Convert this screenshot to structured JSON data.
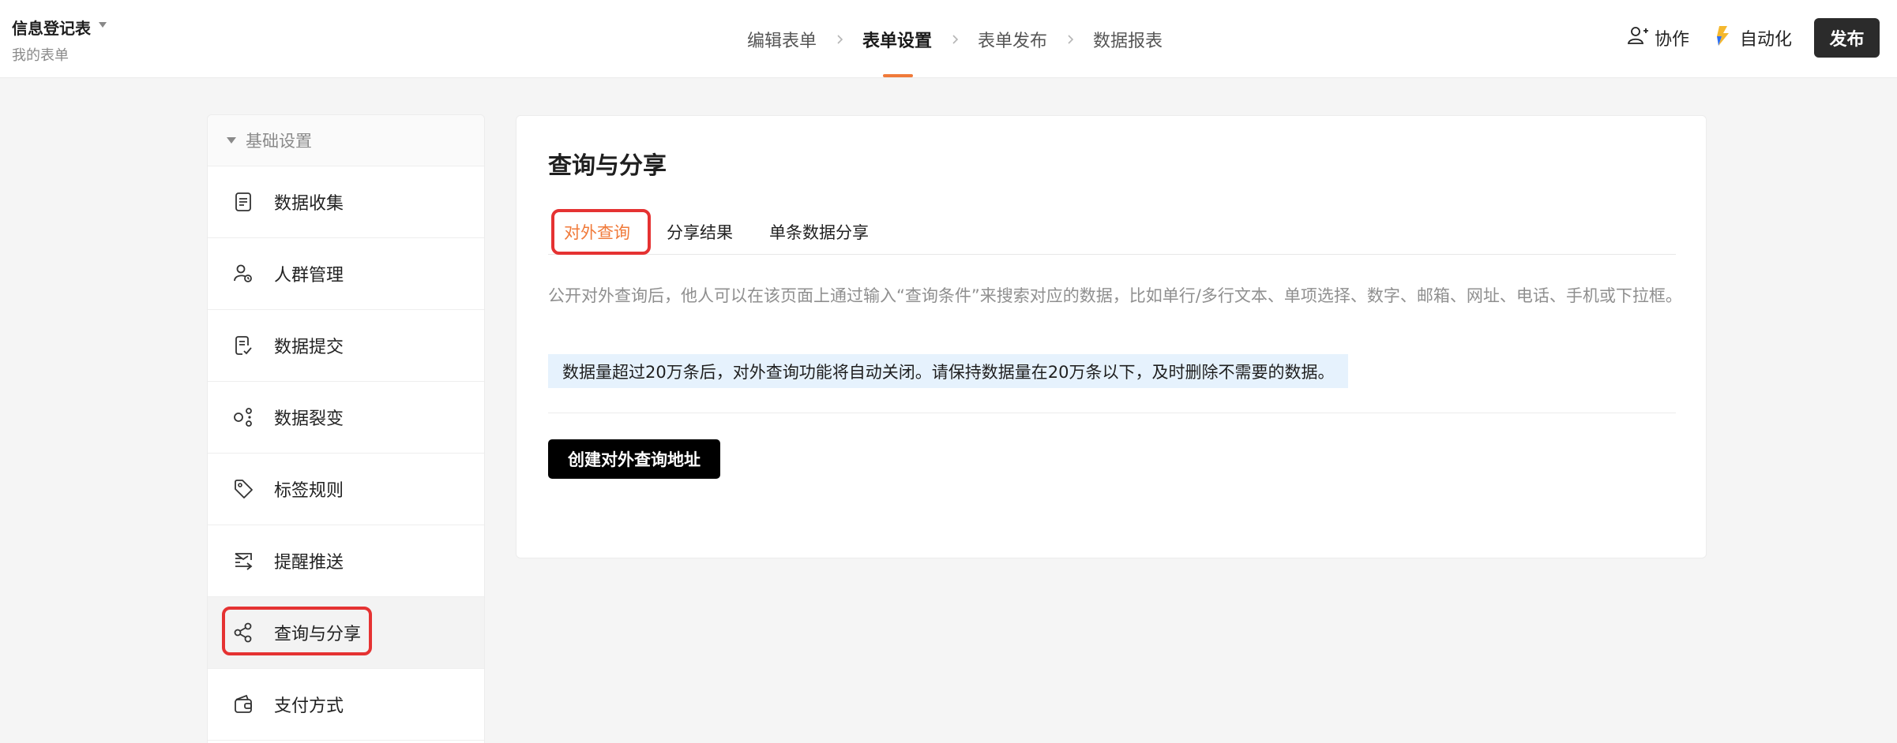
{
  "header": {
    "form_title": "信息登记表",
    "form_subtitle": "我的表单",
    "steps": [
      {
        "label": "编辑表单"
      },
      {
        "label": "表单设置"
      },
      {
        "label": "表单发布"
      },
      {
        "label": "数据报表"
      }
    ],
    "active_step": "表单设置",
    "collab_label": "协作",
    "automation_label": "自动化",
    "publish_label": "发布"
  },
  "sidebar": {
    "section_label": "基础设置",
    "items": [
      {
        "label": "数据收集",
        "icon": "document-icon"
      },
      {
        "label": "人群管理",
        "icon": "people-settings-icon"
      },
      {
        "label": "数据提交",
        "icon": "document-check-icon"
      },
      {
        "label": "数据裂变",
        "icon": "fission-icon"
      },
      {
        "label": "标签规则",
        "icon": "tag-icon"
      },
      {
        "label": "提醒推送",
        "icon": "push-reminder-icon"
      },
      {
        "label": "查询与分享",
        "icon": "share-icon"
      },
      {
        "label": "支付方式",
        "icon": "wallet-icon"
      }
    ],
    "active_item": "查询与分享"
  },
  "main": {
    "title": "查询与分享",
    "tabs": [
      {
        "label": "对外查询"
      },
      {
        "label": "分享结果"
      },
      {
        "label": "单条数据分享"
      }
    ],
    "active_tab": "对外查询",
    "description": "公开对外查询后，他人可以在该页面上通过输入“查询条件”来搜索对应的数据，比如单行/多行文本、单项选择、数字、邮箱、网址、电话、手机或下拉框。",
    "notice": "数据量超过20万条后，对外查询功能将自动关闭。请保持数据量在20万条以下，及时删除不需要的数据。",
    "create_button_label": "创建对外查询地址"
  },
  "colors": {
    "accent": "#f07a3a",
    "highlight_border": "#e53232",
    "notice_bg": "#e6f2fd",
    "publish_bg": "#2b2b2b"
  }
}
